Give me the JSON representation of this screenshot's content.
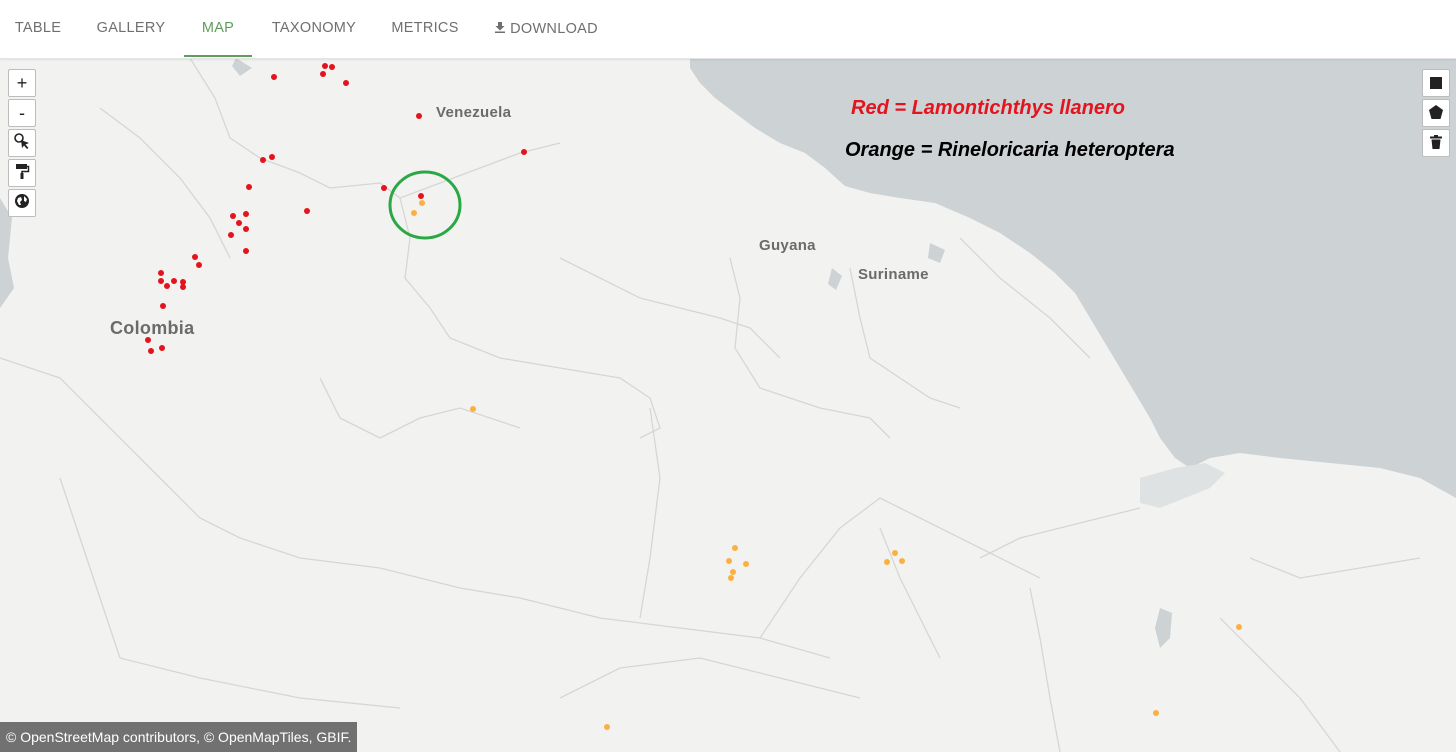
{
  "tabs": [
    {
      "label": "TABLE",
      "active": false
    },
    {
      "label": "GALLERY",
      "active": false
    },
    {
      "label": "MAP",
      "active": true
    },
    {
      "label": "TAXONOMY",
      "active": false
    },
    {
      "label": "METRICS",
      "active": false
    },
    {
      "label": "DOWNLOAD",
      "active": false,
      "icon": "download-icon"
    }
  ],
  "map_controls": {
    "zoom_in": "+",
    "zoom_out": "-",
    "tools": [
      "select-cursor-icon",
      "paint-roller-icon",
      "globe-icon"
    ],
    "draw_tools": [
      "square-icon",
      "pentagon-icon",
      "trash-icon"
    ]
  },
  "map_labels": {
    "venezuela": "Venezuela",
    "colombia": "Colombia",
    "guyana": "Guyana",
    "suriname": "Suriname"
  },
  "legend": {
    "red": "Red = Lamontichthys llanero",
    "orange": "Orange = Rineloricaria heteroptera"
  },
  "colors": {
    "accent": "#5f9d5c",
    "sea": "#cdd2d4",
    "land": "#f2f2f1",
    "red_points": "#e3141e",
    "orange_points": "#fbb040",
    "annotation_circle": "#2aa845"
  },
  "attribution": "© OpenStreetMap contributors, © OpenMapTiles, GBIF."
}
